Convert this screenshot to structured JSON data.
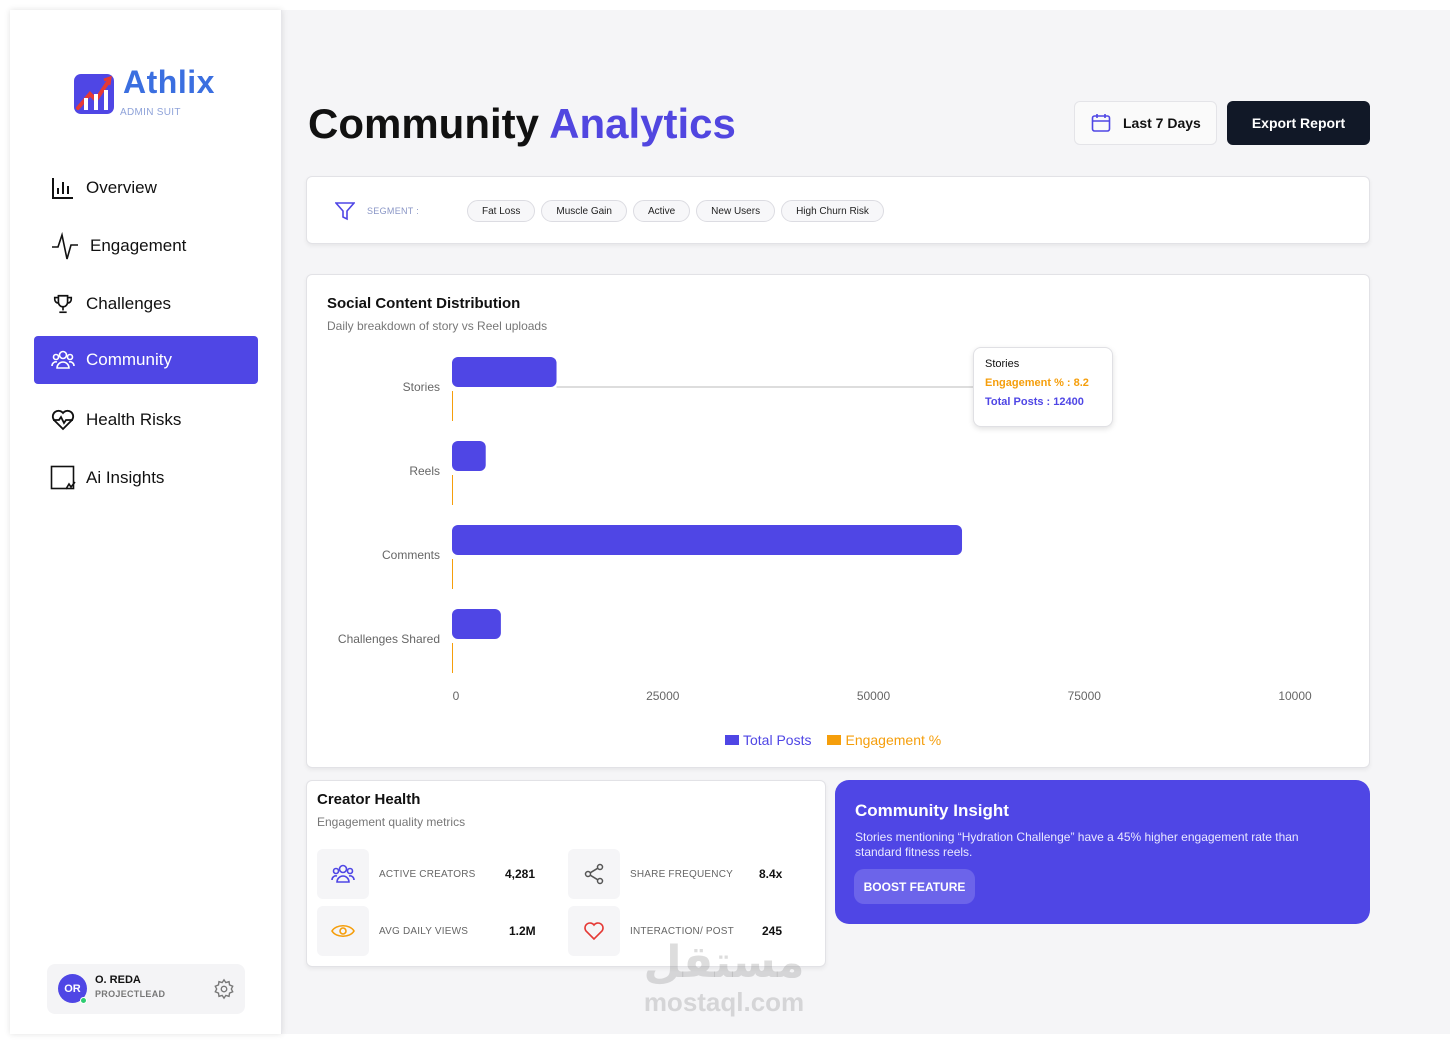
{
  "brand": {
    "name": "Athlix",
    "subtitle": "ADMIN SUIT"
  },
  "sidebar": {
    "items": [
      {
        "label": "Overview",
        "icon": "bar-chart-icon",
        "active": false
      },
      {
        "label": "Engagement",
        "icon": "pulse-icon",
        "active": false
      },
      {
        "label": "Challenges",
        "icon": "trophy-icon",
        "active": false
      },
      {
        "label": "Community",
        "icon": "users-icon",
        "active": true
      },
      {
        "label": "Health Risks",
        "icon": "heart-pulse-icon",
        "active": false
      },
      {
        "label": "Ai Insights",
        "icon": "ai-icon",
        "active": false
      }
    ],
    "user": {
      "initials": "OR",
      "name": "O. REDA",
      "role": "PROJECTLEAD"
    }
  },
  "header": {
    "title_main": "Community",
    "title_accent": "Analytics",
    "date_range": "Last 7 Days",
    "export_label": "Export Report"
  },
  "segment": {
    "label": "SEGMENT :",
    "chips": [
      "Fat Loss",
      "Muscle Gain",
      "Active",
      "New Users",
      "High Churn Risk"
    ]
  },
  "chart": {
    "title": "Social Content Distribution",
    "subtitle": "Daily breakdown of story vs Reel uploads",
    "tooltip": {
      "title": "Stories",
      "engagement": "Engagement % : 8.2",
      "total": "Total Posts : 12400"
    }
  },
  "chart_data": {
    "type": "bar",
    "orientation": "horizontal",
    "categories": [
      "Stories",
      "Reels",
      "Comments",
      "Challenges Shared"
    ],
    "series": [
      {
        "name": "Total Posts",
        "color": "#4f46e5",
        "values": [
          12400,
          4000,
          60500,
          5800
        ]
      },
      {
        "name": "Engagement %",
        "color": "#f59e0b",
        "values": [
          8.2,
          0,
          0,
          0
        ]
      }
    ],
    "x_ticks": [
      "0",
      "25000",
      "50000",
      "75000",
      "10000"
    ],
    "xlim": [
      0,
      100000
    ],
    "legend": "bottom-center"
  },
  "creator_health": {
    "title": "Creator Health",
    "subtitle": "Engagement quality metrics",
    "metrics": [
      {
        "label": "ACTIVE CREATORS",
        "value": "4,281",
        "icon": "users-icon"
      },
      {
        "label": "SHARE FREQUENCY",
        "value": "8.4x",
        "icon": "share-icon"
      },
      {
        "label": "AVG DAILY VIEWS",
        "value": "1.2M",
        "icon": "eye-icon"
      },
      {
        "label": "INTERACTION/ POST",
        "value": "245",
        "icon": "heart-icon"
      }
    ]
  },
  "insight": {
    "title": "Community Insight",
    "body": "Stories mentioning “Hydration Challenge” have a 45% higher engagement rate than standard fitness reels.",
    "button": "BOOST FEATURE"
  },
  "watermark": {
    "arabic": "مستقل",
    "latin": "mostaql.com"
  },
  "colors": {
    "accent": "#4f46e5",
    "engagement": "#f59e0b",
    "dark": "#111827"
  }
}
